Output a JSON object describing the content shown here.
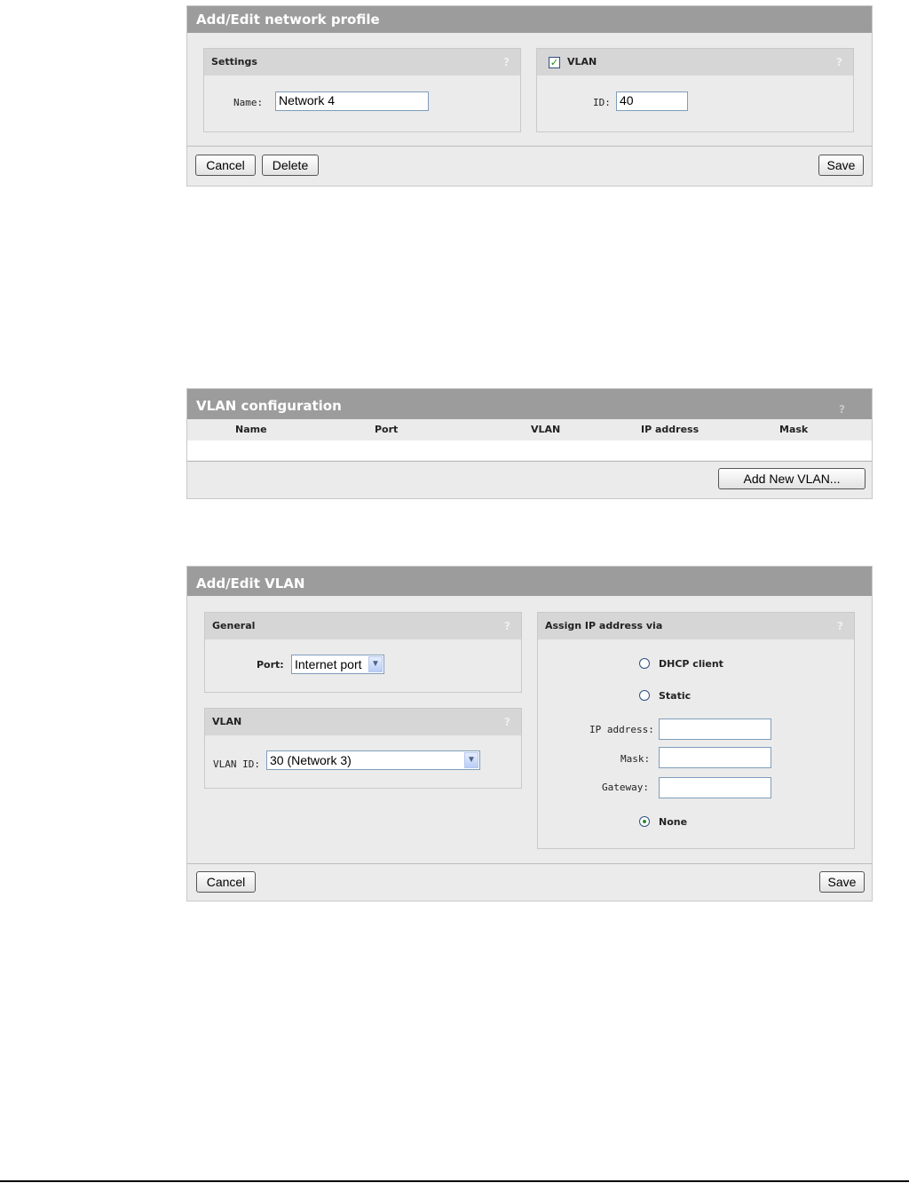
{
  "network_profile": {
    "title": "Add/Edit network profile",
    "settings": {
      "header": "Settings",
      "help": "?",
      "name_label": "Name:",
      "name_value": "Network 4"
    },
    "vlan": {
      "header": "VLAN",
      "checked": true,
      "help": "?",
      "id_label": "ID:",
      "id_value": "40"
    },
    "buttons": {
      "cancel": "Cancel",
      "delete": "Delete",
      "save": "Save"
    }
  },
  "vlan_configuration": {
    "title": "VLAN configuration",
    "help": "?",
    "columns": [
      "Name",
      "Port",
      "VLAN",
      "IP address",
      "Mask"
    ],
    "rows": [],
    "add_button": "Add New VLAN..."
  },
  "edit_vlan": {
    "title": "Add/Edit VLAN",
    "general": {
      "header": "General",
      "help": "?",
      "port_label": "Port:",
      "port_value": "Internet port"
    },
    "vlan": {
      "header": "VLAN",
      "help": "?",
      "vlan_id_label": "VLAN ID:",
      "vlan_id_value": "30 (Network 3)"
    },
    "assign": {
      "header": "Assign IP address via",
      "help": "?",
      "dhcp_label": "DHCP client",
      "static_label": "Static",
      "ip_label": "IP address:",
      "ip_value": "",
      "mask_label": "Mask:",
      "mask_value": "",
      "gateway_label": "Gateway:",
      "gateway_value": "",
      "none_label": "None",
      "selected": "None"
    },
    "buttons": {
      "cancel": "Cancel",
      "save": "Save"
    }
  },
  "icons": {
    "dropdown": "chevron-down-icon",
    "checkbox": "checkmark-icon",
    "help": "help-icon"
  },
  "colors": {
    "title_bar": "#9c9c9c",
    "panel_bg": "#ebebeb",
    "box_header": "#d6d6d6",
    "check": "#1a8a1a"
  }
}
